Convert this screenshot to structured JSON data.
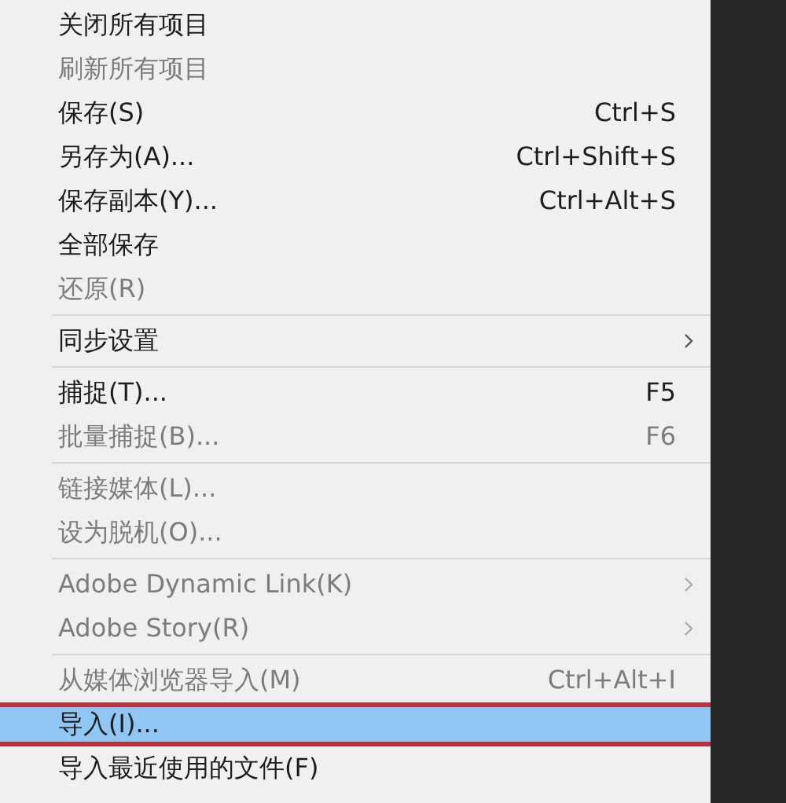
{
  "menu": {
    "items": [
      {
        "kind": "item",
        "label": "关闭所有项目",
        "disabled": false,
        "selected": false
      },
      {
        "kind": "item",
        "label": "刷新所有项目",
        "disabled": true,
        "selected": false
      },
      {
        "kind": "item",
        "label": "保存(S)",
        "shortcut": "Ctrl+S",
        "disabled": false,
        "selected": false
      },
      {
        "kind": "item",
        "label": "另存为(A)...",
        "shortcut": "Ctrl+Shift+S",
        "disabled": false,
        "selected": false
      },
      {
        "kind": "item",
        "label": "保存副本(Y)...",
        "shortcut": "Ctrl+Alt+S",
        "disabled": false,
        "selected": false
      },
      {
        "kind": "item",
        "label": "全部保存",
        "disabled": false,
        "selected": false
      },
      {
        "kind": "item",
        "label": "还原(R)",
        "disabled": true,
        "selected": false
      },
      {
        "kind": "separator"
      },
      {
        "kind": "item",
        "label": "同步设置",
        "submenu": true,
        "disabled": false,
        "selected": false
      },
      {
        "kind": "separator"
      },
      {
        "kind": "item",
        "label": "捕捉(T)...",
        "shortcut": "F5",
        "disabled": false,
        "selected": false
      },
      {
        "kind": "item",
        "label": "批量捕捉(B)...",
        "shortcut": "F6",
        "disabled": true,
        "selected": false
      },
      {
        "kind": "separator"
      },
      {
        "kind": "item",
        "label": "链接媒体(L)...",
        "disabled": true,
        "selected": false
      },
      {
        "kind": "item",
        "label": "设为脱机(O)...",
        "disabled": true,
        "selected": false
      },
      {
        "kind": "separator"
      },
      {
        "kind": "item",
        "label": "Adobe Dynamic Link(K)",
        "submenu": true,
        "disabled": true,
        "selected": false
      },
      {
        "kind": "item",
        "label": "Adobe Story(R)",
        "submenu": true,
        "disabled": true,
        "selected": false
      },
      {
        "kind": "separator"
      },
      {
        "kind": "item",
        "label": "从媒体浏览器导入(M)",
        "shortcut": "Ctrl+Alt+I",
        "disabled": true,
        "selected": false
      },
      {
        "kind": "item",
        "label": "导入(I)...",
        "disabled": false,
        "selected": true
      },
      {
        "kind": "item",
        "label": "导入最近使用的文件(F)",
        "disabled": false,
        "selected": false
      }
    ]
  }
}
